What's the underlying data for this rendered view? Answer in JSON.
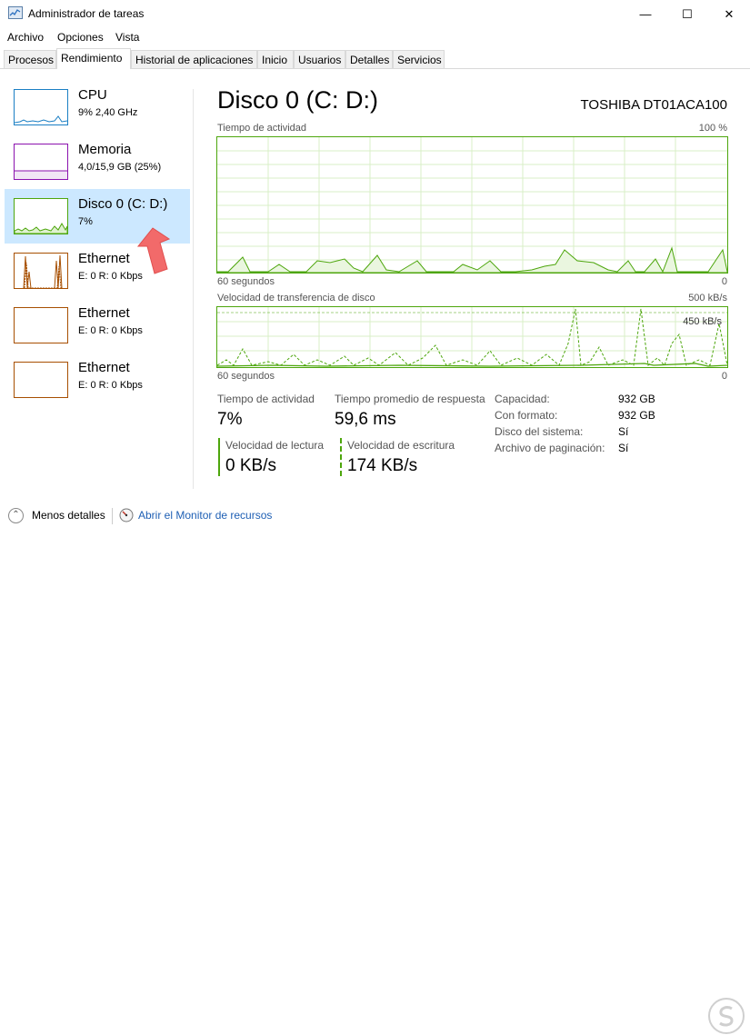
{
  "window": {
    "title": "Administrador de tareas",
    "minimize_glyph": "—",
    "maximize_glyph": "☐",
    "close_glyph": "✕"
  },
  "menu": [
    "Archivo",
    "Opciones",
    "Vista"
  ],
  "tabs": [
    "Procesos",
    "Rendimiento",
    "Historial de aplicaciones",
    "Inicio",
    "Usuarios",
    "Detalles",
    "Servicios"
  ],
  "active_tab": "Rendimiento",
  "sidebar": [
    {
      "title": "CPU",
      "subtitle": "9% 2,40 GHz",
      "color": "#1a7fc4",
      "selected": false
    },
    {
      "title": "Memoria",
      "subtitle": "4,0/15,9 GB (25%)",
      "color": "#8b12ae",
      "selected": false
    },
    {
      "title": "Disco 0 (C: D:)",
      "subtitle": "7%",
      "color": "#4da60c",
      "selected": true
    },
    {
      "title": "Ethernet",
      "subtitle_prefix": "E: 0 R: 0 Kbps",
      "color": "#a74f01",
      "selected": false
    },
    {
      "title": "Ethernet",
      "subtitle_prefix": "E: 0 R: 0 Kbps",
      "color": "#a74f01",
      "selected": false
    },
    {
      "title": "Ethernet",
      "subtitle_prefix": "E: 0 R: 0 Kbps",
      "color": "#a74f01",
      "selected": false
    }
  ],
  "detail": {
    "title": "Disco 0 (C: D:)",
    "device": "TOSHIBA DT01ACA100",
    "activity_graph": {
      "label": "Tiempo de actividad",
      "max": "100 %",
      "time": "60 segundos",
      "min": "0"
    },
    "transfer_graph": {
      "label": "Velocidad de transferencia de disco",
      "max": "500 kB/s",
      "line_label": "450 kB/s",
      "time": "60 segundos",
      "min": "0"
    },
    "stats": {
      "activity_label": "Tiempo de actividad",
      "activity_value": "7%",
      "response_label": "Tiempo promedio de respuesta",
      "response_value": "59,6 ms",
      "read_label": "Velocidad de lectura",
      "read_value": "0 KB/s",
      "write_label": "Velocidad de escritura",
      "write_value": "174 KB/s"
    },
    "properties": [
      {
        "label": "Capacidad:",
        "value": "932 GB"
      },
      {
        "label": "Con formato:",
        "value": "932 GB"
      },
      {
        "label": "Disco del sistema:",
        "value": "Sí"
      },
      {
        "label": "Archivo de paginación:",
        "value": "Sí"
      }
    ]
  },
  "footer": {
    "fewer_details": "Menos detalles",
    "resource_monitor": "Abrir el Monitor de recursos"
  },
  "icons": {
    "app": "task-manager-icon",
    "fewer": "chevron-up-icon",
    "resmon": "resource-monitor-icon",
    "annotation": "red-arrow-icon",
    "watermark": "watermark-logo"
  },
  "colors": {
    "accent_disk": "#4da60c",
    "accent_cpu": "#1a7fc4",
    "accent_memory": "#8b12ae",
    "accent_ethernet": "#a74f01",
    "selected_bg": "#cce8ff",
    "link": "#1e5fb4",
    "annotation": "#f26a6a"
  }
}
